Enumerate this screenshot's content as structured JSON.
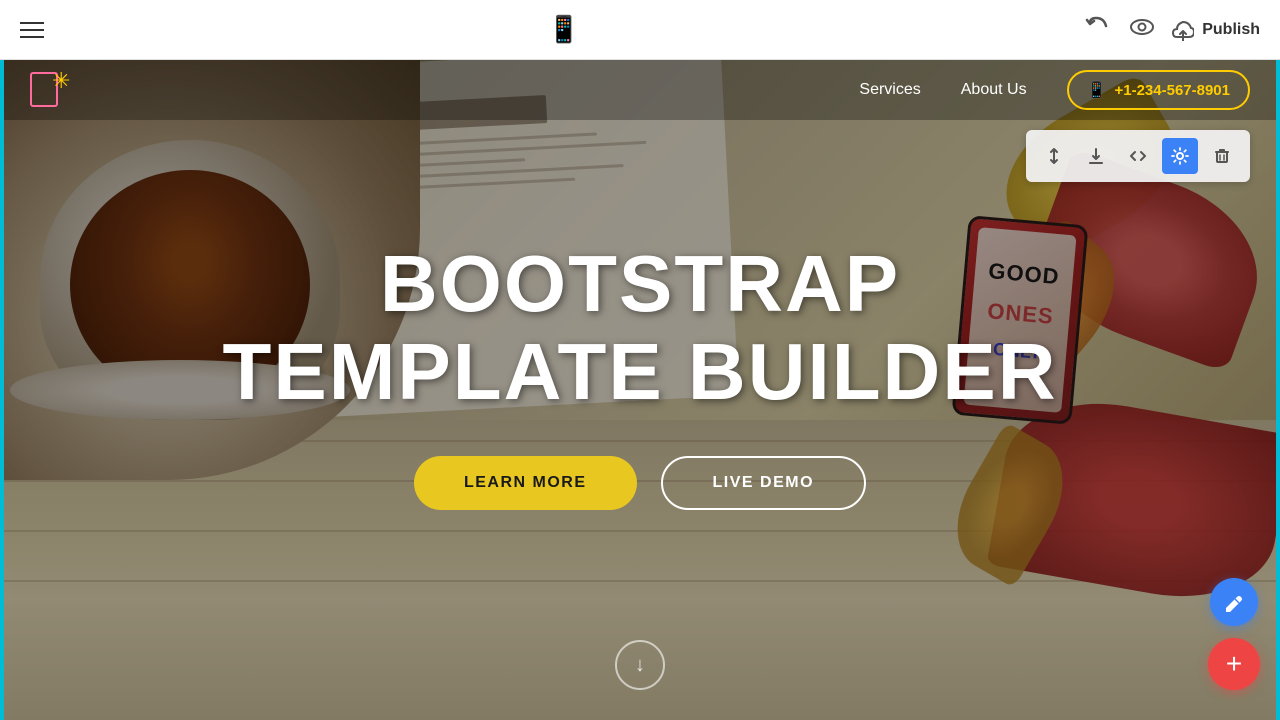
{
  "toolbar": {
    "menu_icon": "☰",
    "phone_icon": "📱",
    "undo_icon": "↩",
    "eye_icon": "👁",
    "cloud_icon": "☁",
    "publish_label": "Publish"
  },
  "nav": {
    "services_label": "Services",
    "about_label": "About Us",
    "phone_number": "+1-234-567-8901",
    "phone_icon": "📞"
  },
  "hero": {
    "title_line1": "BOOTSTRAP",
    "title_line2": "TEMPLATE BUILDER",
    "btn_learn": "LEARN MORE",
    "btn_demo": "LIVE DEMO",
    "scroll_arrow": "↓"
  },
  "float_toolbar": {
    "sort_icon": "⇅",
    "download_icon": "⬇",
    "code_icon": "</>",
    "settings_icon": "⚙",
    "delete_icon": "🗑"
  },
  "fab": {
    "edit_icon": "✏",
    "add_icon": "+"
  }
}
